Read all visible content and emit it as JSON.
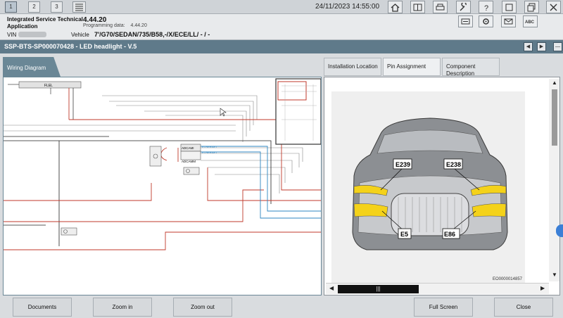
{
  "topbar": {
    "tabs": [
      "1",
      "2",
      "3"
    ],
    "datetime": "24/11/2023 14:55:00",
    "icons": [
      "home-icon",
      "manual-icon",
      "print-icon",
      "wrench-icon",
      "help-icon",
      "window-icon",
      "minimize-icon",
      "close-icon"
    ]
  },
  "info": {
    "app_name": "Integrated Service Technical Application",
    "version": "4.44.20",
    "programming_label": "Programming data:",
    "programming_value": "4.44.20",
    "vin_label": "VIN",
    "vehicle_label": "Vehicle",
    "vehicle_value": "7'/G70/SEDAN/735/B58,-/X/ECE/LL/ - / -",
    "buttons": [
      "scan-icon",
      "settings-icon",
      "mail-icon",
      "abc-icon"
    ]
  },
  "title": {
    "text": "SSP-BTS-SP000070428 - LED headlight - V.5"
  },
  "left": {
    "tab": "Wiring Diagram",
    "labels": {
      "fuse": "FLEL",
      "con1": "ADCAMI",
      "con2": "ADCAMM",
      "eth1": "ETHERNET",
      "eth2": "ETHERNET",
      "e_top": "E239",
      "e_low": "E5"
    }
  },
  "right": {
    "tabs": [
      "Installation Location",
      "Pin Assignment",
      "Component Description"
    ],
    "callouts": [
      "E239",
      "E238",
      "E5",
      "E86"
    ],
    "image_id": "EO0000014857"
  },
  "bottom": {
    "documents": "Documents",
    "zoom_in": "Zoom in",
    "zoom_out": "Zoom out",
    "full_screen": "Full Screen",
    "close": "Close"
  }
}
